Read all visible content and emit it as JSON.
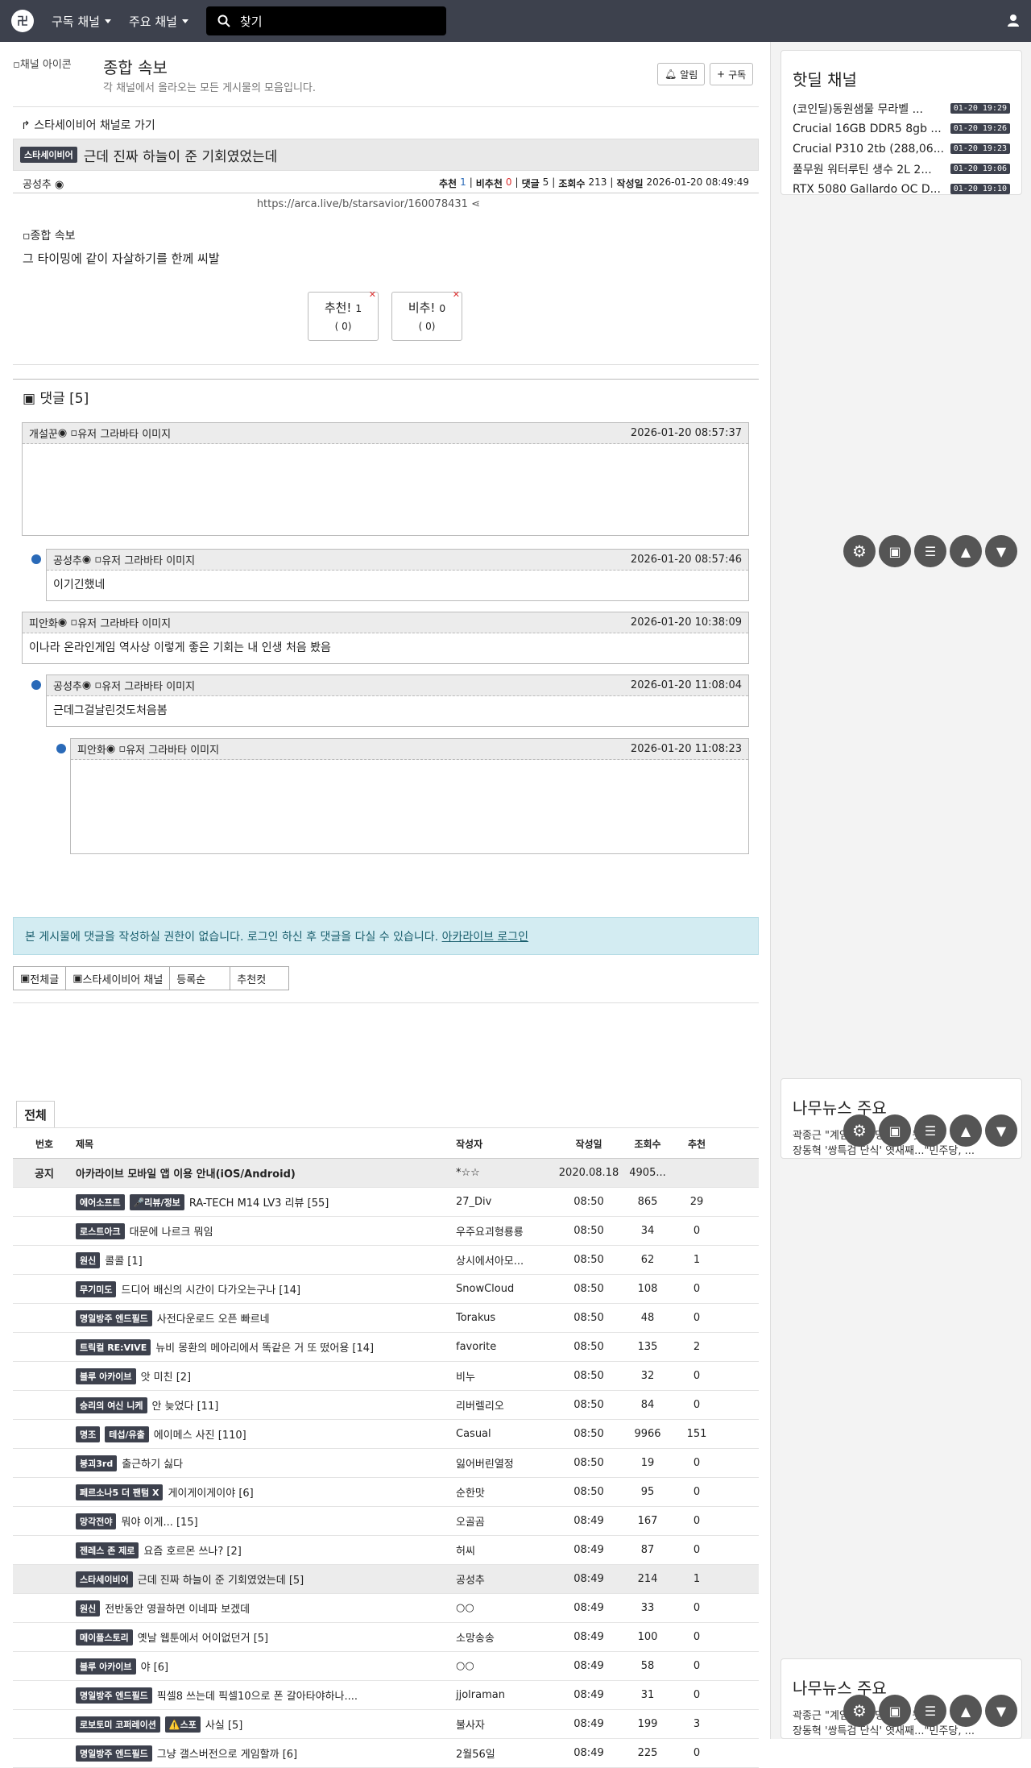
{
  "nav": {
    "subscribed": "구독 채널",
    "major": "주요 채널",
    "search_placeholder": "찾기"
  },
  "header": {
    "channel_img_alt": "채널 아이콘",
    "title": "종합 속보",
    "desc": "각 채널에서 올라오는 모든 게시물의 모음입니다.",
    "alarm": "알림",
    "subscribe": "구독"
  },
  "article": {
    "goto": "스타세이비어 채널로 가기",
    "badge": "스타세이비어",
    "title": "근데 진짜 하늘이 준 기회였었는데",
    "author": "공성추",
    "rec_label": "추천",
    "rec": "1",
    "unrec_label": "비추천",
    "unrec": "0",
    "cmt_label": "댓글",
    "cmt": "5",
    "views_label": "조회수",
    "views": "213",
    "date_label": "작성일",
    "date": "2026-01-20 08:49:49",
    "url": "https://arca.live/b/starsavior/160078431",
    "img_alt": "종합 속보",
    "body": "그 타이밍에 같이 자살하기를 한께 씨발",
    "vote_up": "추천!",
    "vote_up_n": "1",
    "vote_up_sub": "( 0)",
    "vote_down": "비추!",
    "vote_down_n": "0",
    "vote_down_sub": "( 0)"
  },
  "comments_title": "댓글 [5]",
  "comments": [
    {
      "author": "개설꾼",
      "avatar": "유저 그라바타 이미지",
      "date": "2026-01-20 08:57:37",
      "text": ""
    },
    {
      "author": "공성추",
      "avatar": "유저 그라바타 이미지",
      "date": "2026-01-20 08:57:46",
      "text": "이기긴했네"
    },
    {
      "author": "피안화",
      "avatar": "유저 그라바타 이미지",
      "date": "2026-01-20 10:38:09",
      "text": "이나라 온라인게임 역사상 이렇게 좋은 기회는 내 인생 처음 봤음"
    },
    {
      "author": "공성추",
      "avatar": "유저 그라바타 이미지",
      "date": "2026-01-20 11:08:04",
      "text": "근데그걸날린것도처음봄"
    },
    {
      "author": "피안화",
      "avatar": "유저 그라바타 이미지",
      "date": "2026-01-20 11:08:23",
      "text": ""
    }
  ],
  "notice": {
    "text": "본 게시물에 댓글을 작성하실 권한이 없습니다. 로그인 하신 후 댓글을 다실 수 있습니다. ",
    "link": "아카라이브 로그인"
  },
  "filters": [
    "전체글",
    "스타세이비어 채널",
    "등록순",
    "추천컷"
  ],
  "list_tab": "전체",
  "table": {
    "headers": [
      "번호",
      "제목",
      "작성자",
      "작성일",
      "조회수",
      "추천"
    ],
    "notice_row": {
      "no": "공지",
      "title": "아카라이브 모바일 앱 이용 안내(iOS/Android)",
      "author": "*☆☆",
      "date": "2020.08.18",
      "views": "4905...",
      "rec": ""
    },
    "rows": [
      {
        "badges": [
          "에어소프트",
          "🎤리뷰/정보"
        ],
        "title": "RA-TECH M14 LV3 리뷰 [55]",
        "author": "27_Div",
        "date": "08:50",
        "views": "865",
        "rec": "29"
      },
      {
        "badges": [
          "로스트아크"
        ],
        "title": "대문에 나르크 뭐임",
        "author": "우주요괴형룡룡",
        "date": "08:50",
        "views": "34",
        "rec": "0"
      },
      {
        "badges": [
          "원신"
        ],
        "title": "콜콜 [1]",
        "author": "상시에서아모...",
        "date": "08:50",
        "views": "62",
        "rec": "1"
      },
      {
        "badges": [
          "무기미도"
        ],
        "title": "드디어 배신의 시간이 다가오는구나 [14]",
        "author": "SnowCloud",
        "date": "08:50",
        "views": "108",
        "rec": "0"
      },
      {
        "badges": [
          "명일방주 엔드필드"
        ],
        "title": "사전다운로드 오픈 빠르네",
        "author": "Torakus",
        "date": "08:50",
        "views": "48",
        "rec": "0"
      },
      {
        "badges": [
          "트릭컬 RE:VIVE"
        ],
        "title": "뉴비 몽환의 메아리에서 똑같은 거 또 떴어용 [14]",
        "author": "favorite",
        "date": "08:50",
        "views": "135",
        "rec": "2"
      },
      {
        "badges": [
          "블루 아카이브"
        ],
        "title": "앗 미친 [2]",
        "author": "비누",
        "date": "08:50",
        "views": "32",
        "rec": "0"
      },
      {
        "badges": [
          "승리의 여신 니케"
        ],
        "title": "안 늦었다 [11]",
        "author": "리버렐리오",
        "date": "08:50",
        "views": "84",
        "rec": "0"
      },
      {
        "badges": [
          "명조",
          "테섭/유출"
        ],
        "title": "에이메스 사진 [110]",
        "author": "Casual",
        "date": "08:50",
        "views": "9966",
        "rec": "151"
      },
      {
        "badges": [
          "붕괴3rd"
        ],
        "title": "출근하기 싫다",
        "author": "잃어버린열정",
        "date": "08:50",
        "views": "19",
        "rec": "0"
      },
      {
        "badges": [
          "페르소나5 더 팬텀 X"
        ],
        "title": "게이게이게이야 [6]",
        "author": "순한맛",
        "date": "08:50",
        "views": "95",
        "rec": "0"
      },
      {
        "badges": [
          "망각전야"
        ],
        "title": "뭐야 이게... [15]",
        "author": "오골곰",
        "date": "08:49",
        "views": "167",
        "rec": "0"
      },
      {
        "badges": [
          "젠레스 존 제로"
        ],
        "title": "요즘 호르몬 쓰나? [2]",
        "author": "허씨",
        "date": "08:49",
        "views": "87",
        "rec": "0"
      },
      {
        "badges": [
          "스타세이비어"
        ],
        "title": "근데 진짜 하늘이 준 기회였었는데 [5]",
        "author": "공성추",
        "date": "08:49",
        "views": "214",
        "rec": "1",
        "hl": true
      },
      {
        "badges": [
          "원신"
        ],
        "title": "전반동안 영끌하면 이네파 보겠데",
        "author": "○○",
        "date": "08:49",
        "views": "33",
        "rec": "0"
      },
      {
        "badges": [
          "메이플스토리"
        ],
        "title": "옛날 웹툰에서 어이없던거 [5]",
        "author": "소망송송",
        "date": "08:49",
        "views": "100",
        "rec": "0"
      },
      {
        "badges": [
          "블루 아카이브"
        ],
        "title": "야 [6]",
        "author": "○○",
        "date": "08:49",
        "views": "58",
        "rec": "0"
      },
      {
        "badges": [
          "명일방주 엔드필드"
        ],
        "title": "픽셀8 쓰는데 픽셀10으로 폰 갈아타야하나....",
        "author": "jjolraman",
        "date": "08:49",
        "views": "31",
        "rec": "0"
      },
      {
        "badges": [
          "로보토미 코퍼레이션",
          "⚠️스포"
        ],
        "title": "사실 [5]",
        "author": "불사자",
        "date": "08:49",
        "views": "199",
        "rec": "3"
      },
      {
        "badges": [
          "명일방주 엔드필드"
        ],
        "title": "그냥 갤스버전으로 게임할까 [6]",
        "author": "2월56일",
        "date": "08:49",
        "views": "225",
        "rec": "0"
      }
    ]
  },
  "sidebar": {
    "hot_title": "핫딜 채널",
    "hot": [
      {
        "t": "(코인딜)동원샘물 무라벨 ...",
        "d": "01-20 19:29"
      },
      {
        "t": "Crucial 16GB DDR5 8gb ...",
        "d": "01-20 19:26"
      },
      {
        "t": "Crucial P310 2tb (288,06...",
        "d": "01-20 19:23"
      },
      {
        "t": "풀무원 워터루틴 생수 2L 2...",
        "d": "01-20 19:06"
      },
      {
        "t": "RTX 5080 Gallardo OC D...",
        "d": "01-20 19:10"
      }
    ],
    "news_title": "나무뉴스 주요",
    "news": [
      "곽종근 \"계엄 당시 명령...\" 뒷...",
      "장동혁 '쌍특검 단식' 엿새째...\"민주당, ..."
    ]
  }
}
